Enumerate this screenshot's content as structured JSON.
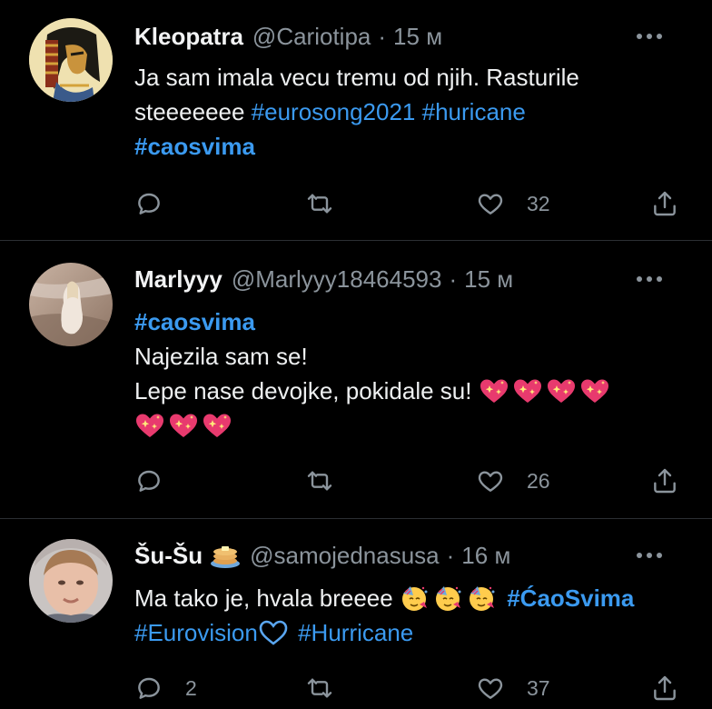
{
  "tweets": [
    {
      "name": "Kleopatra",
      "handle": "@Cariotipa",
      "time": "15 м",
      "lines": [
        [
          {
            "t": "Ja sam imala vecu tremu od njih. Rasturile"
          }
        ],
        [
          {
            "t": "steeeeeee "
          },
          {
            "h": "#eurosong2021"
          },
          {
            "t": " "
          },
          {
            "h": "#huricane"
          }
        ],
        [
          {
            "hb": "#caosvima"
          }
        ]
      ],
      "replies": "",
      "likes": "32",
      "avatar_icon": "cleopatra-avatar"
    },
    {
      "name": "Marlyyy",
      "handle": "@Marlyyy18464593",
      "time": "15 м",
      "lines": [
        [
          {
            "hb": "#caosvima"
          }
        ],
        [
          {
            "t": "Najezila sam se!"
          }
        ],
        [
          {
            "t": "Lepe nase devojke, pokidale su! "
          },
          {
            "e": "sparkling-heart"
          },
          {
            "e": "sparkling-heart"
          },
          {
            "e": "sparkling-heart"
          },
          {
            "e": "sparkling-heart"
          }
        ],
        [
          {
            "e": "sparkling-heart"
          },
          {
            "e": "sparkling-heart"
          },
          {
            "e": "sparkling-heart"
          }
        ]
      ],
      "replies": "",
      "likes": "26",
      "avatar_icon": "beach-photo-avatar"
    },
    {
      "name": "Šu-Šu",
      "handle": "@samojednasusa",
      "time": "16 м",
      "name_emoji": "pancakes",
      "lines": [
        [
          {
            "t": "Ma tako je, hvala breeee "
          },
          {
            "e": "partying-face"
          },
          {
            "e": "partying-face"
          },
          {
            "e": "partying-face"
          },
          {
            "t": " "
          },
          {
            "hb": "#ĆaoSvima"
          }
        ],
        [
          {
            "h": "#Eurovision"
          },
          {
            "e": "blue-heart"
          },
          {
            "t": " "
          },
          {
            "h": "#Hurricane"
          }
        ]
      ],
      "replies": "2",
      "likes": "37",
      "avatar_icon": "selfie-avatar"
    }
  ],
  "colors": {
    "background": "#000000",
    "text": "#e7e9ea",
    "muted": "#8b949c",
    "link": "#3b9af0",
    "divider": "#2b2f33"
  },
  "icons": {
    "reply": "reply-icon",
    "retweet": "retweet-icon",
    "like": "heart-icon",
    "share": "share-icon",
    "more": "more-icon"
  }
}
